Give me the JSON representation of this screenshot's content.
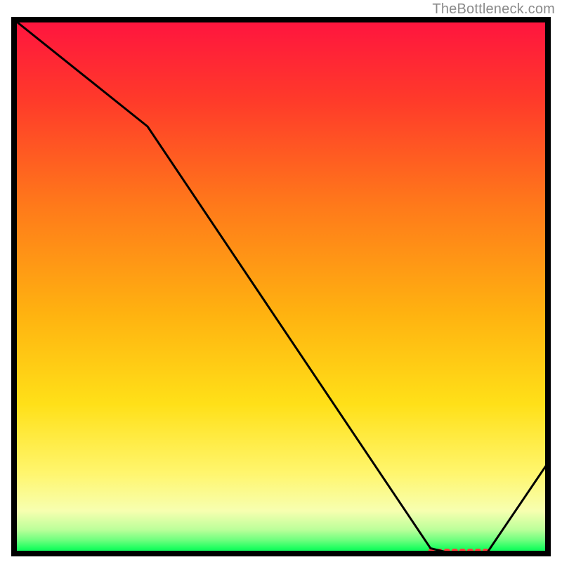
{
  "attribution": "TheBottleneck.com",
  "chart_data": {
    "type": "line",
    "title": "",
    "xlabel": "",
    "ylabel": "",
    "xlim": [
      0,
      100
    ],
    "ylim": [
      0,
      100
    ],
    "x": [
      0,
      5,
      25,
      78,
      82,
      88.5,
      100
    ],
    "y": [
      100,
      96,
      80,
      1,
      0,
      0,
      17
    ],
    "notes": "Single black line over a vertical rainbow gradient background (red at top through orange/yellow to green at bottom). No tick labels or legend are visible.",
    "colors": {
      "gradient_stops": [
        {
          "offset": 0.0,
          "color": "#ff143f"
        },
        {
          "offset": 0.15,
          "color": "#ff3a2a"
        },
        {
          "offset": 0.35,
          "color": "#ff7a1a"
        },
        {
          "offset": 0.55,
          "color": "#ffb210"
        },
        {
          "offset": 0.72,
          "color": "#ffe018"
        },
        {
          "offset": 0.85,
          "color": "#fff66e"
        },
        {
          "offset": 0.92,
          "color": "#f7ffb0"
        },
        {
          "offset": 0.955,
          "color": "#bcff9a"
        },
        {
          "offset": 0.975,
          "color": "#6dff7e"
        },
        {
          "offset": 0.99,
          "color": "#1fff60"
        },
        {
          "offset": 1.0,
          "color": "#00e856"
        }
      ],
      "marker_color": "#ff3a3a",
      "line_color": "#000000",
      "frame_color": "#000000"
    },
    "marker_segment_x": [
      78,
      88.5
    ]
  }
}
